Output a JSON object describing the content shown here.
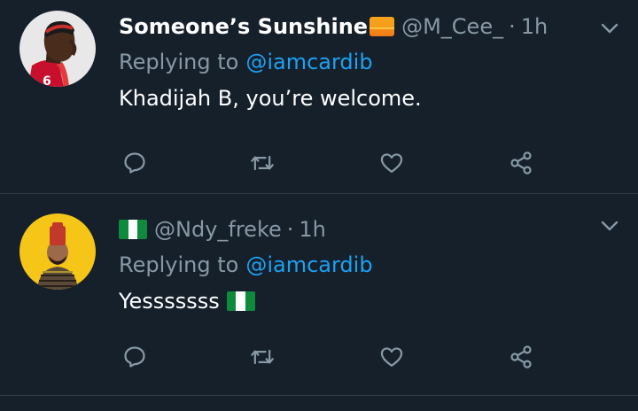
{
  "tweets": [
    {
      "display_name": "Someone’s Sunshine",
      "name_emoji": "sunrise-emoji",
      "handle": "@M_Cee_",
      "separator": "·",
      "time": "1h",
      "replying_prefix": "Replying to",
      "replying_to": "@iamcardib",
      "text": "Khadijah B, you’re welcome."
    },
    {
      "display_name": "",
      "name_emoji": "nigeria-flag-emoji",
      "handle": "@Ndy_freke",
      "separator": "·",
      "time": "1h",
      "replying_prefix": "Replying to",
      "replying_to": "@iamcardib",
      "text": "Yesssssss",
      "text_emoji": "nigeria-flag-emoji"
    }
  ],
  "actions": [
    "reply-icon",
    "retweet-icon",
    "like-icon",
    "share-icon"
  ],
  "colors": {
    "background": "#15202b",
    "secondary_text": "#8899a6",
    "link": "#1da1f2",
    "divider": "#2f3b47"
  }
}
